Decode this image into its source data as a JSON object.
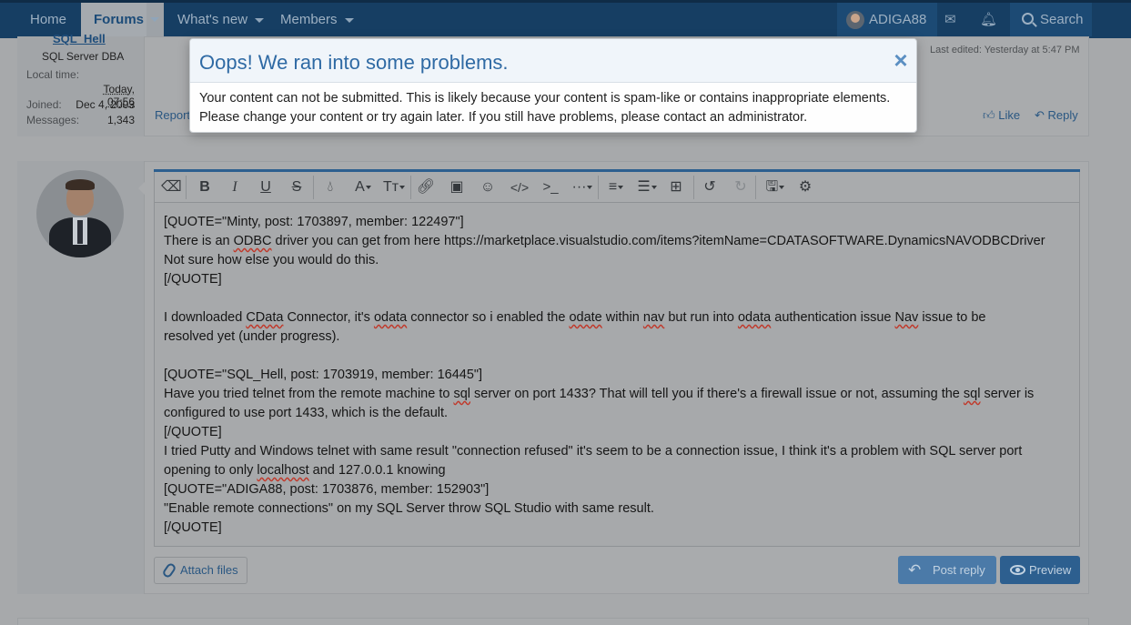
{
  "nav": {
    "home": "Home",
    "forums": "Forums",
    "whats_new": "What's new",
    "members": "Members",
    "username": "ADIGA88",
    "search": "Search"
  },
  "post1": {
    "author": "SQL_Hell",
    "title": "SQL Server DBA",
    "local_time_label": "Local time:",
    "local_time_value": "Today, 07:56",
    "joined_label": "Joined:",
    "joined_value": "Dec 4, 2003",
    "messages_label": "Messages:",
    "messages_value": "1,343",
    "report": "Report",
    "last_edited": "Last edited: Yesterday at 5:47 PM",
    "like": "Like",
    "reply": "Reply"
  },
  "editor": {
    "lines": [
      "[QUOTE=\"Minty, post: 1703897, member: 122497\"]",
      "There is an ODBC driver you can get from here https://marketplace.visualstudio.com/items?itemName=CDATASOFTWARE.DynamicsNAVODBCDriver",
      "Not sure how else you would do this.",
      "[/QUOTE]",
      "",
      "I downloaded CData Connector,  it's odata connector so i enabled the odate within nav but run into odata authentication issue  Nav issue to be",
      "resolved yet (under progress).",
      "",
      "[QUOTE=\"SQL_Hell, post: 1703919, member: 16445\"]",
      "Have you tried telnet from the remote machine to sql server on port 1433? That will tell you if there's a firewall issue or not, assuming the sql server is",
      "configured to use port 1433, which is the default.",
      "[/QUOTE]",
      "I tried Putty and Windows telnet with same result \"connection refused\" it's seem to be a connection issue, I think it's a problem with SQL server port",
      "opening to only localhost and 127.0.0.1 knowing",
      "[QUOTE=\"ADIGA88, post: 1703876, member: 152903\"]",
      "\"Enable remote connections\" on my SQL Server throw SQL Studio with same result.",
      "[/QUOTE]"
    ],
    "attach_files": "Attach files",
    "post_reply": "Post reply",
    "preview": "Preview"
  },
  "modal": {
    "title": "Oops! We ran into some problems.",
    "close": "×",
    "message": "Your content can not be submitted. This is likely because your content is spam-like or contains inappropriate elements. Please change your content or try again later. If you still have problems, please contact an administrator."
  },
  "icons": {
    "toolbar": [
      "eraser-icon",
      "bold-icon",
      "italic-icon",
      "underline-icon",
      "strikethrough-icon",
      "text-color-icon",
      "font-family-icon",
      "font-size-icon",
      "link-icon",
      "image-icon",
      "smilie-icon",
      "code-icon",
      "inline-code-icon",
      "more-options-icon",
      "align-icon",
      "list-icon",
      "table-icon",
      "undo-icon",
      "redo-icon",
      "drafts-icon",
      "settings-icon"
    ]
  }
}
